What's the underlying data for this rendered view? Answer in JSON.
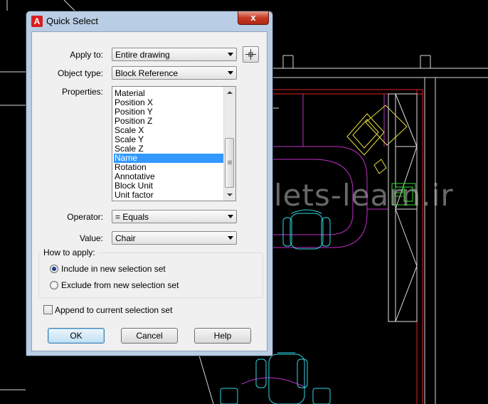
{
  "dialog": {
    "title": "Quick Select",
    "close_label": "x",
    "app_icon_label": "A"
  },
  "form": {
    "apply_to_label": "Apply to:",
    "apply_to_value": "Entire drawing",
    "object_type_label": "Object type:",
    "object_type_value": "Block Reference",
    "properties_label": "Properties:",
    "properties": [
      "Material",
      "Position X",
      "Position Y",
      "Position Z",
      "Scale X",
      "Scale Y",
      "Scale Z",
      "Name",
      "Rotation",
      "Annotative",
      "Block Unit",
      "Unit factor"
    ],
    "selected_property": "Name",
    "operator_label": "Operator:",
    "operator_value": "= Equals",
    "value_label": "Value:",
    "value_value": "Chair"
  },
  "how_to_apply": {
    "title": "How to apply:",
    "include_label": "Include in new selection set",
    "exclude_label": "Exclude from new selection set",
    "selected": "include"
  },
  "append_label": "Append to current selection set",
  "append_checked": false,
  "buttons": {
    "ok": "OK",
    "cancel": "Cancel",
    "help": "Help"
  },
  "watermark": "lets-learn.ir",
  "colors": {
    "dialog_frame": "#b9cde4",
    "selection": "#3399ff",
    "cad_background": "#000000"
  },
  "icons": {
    "pick_button": "crosshair-icon",
    "app": "autocad-icon",
    "cursor": "mouse-pointer-icon"
  }
}
